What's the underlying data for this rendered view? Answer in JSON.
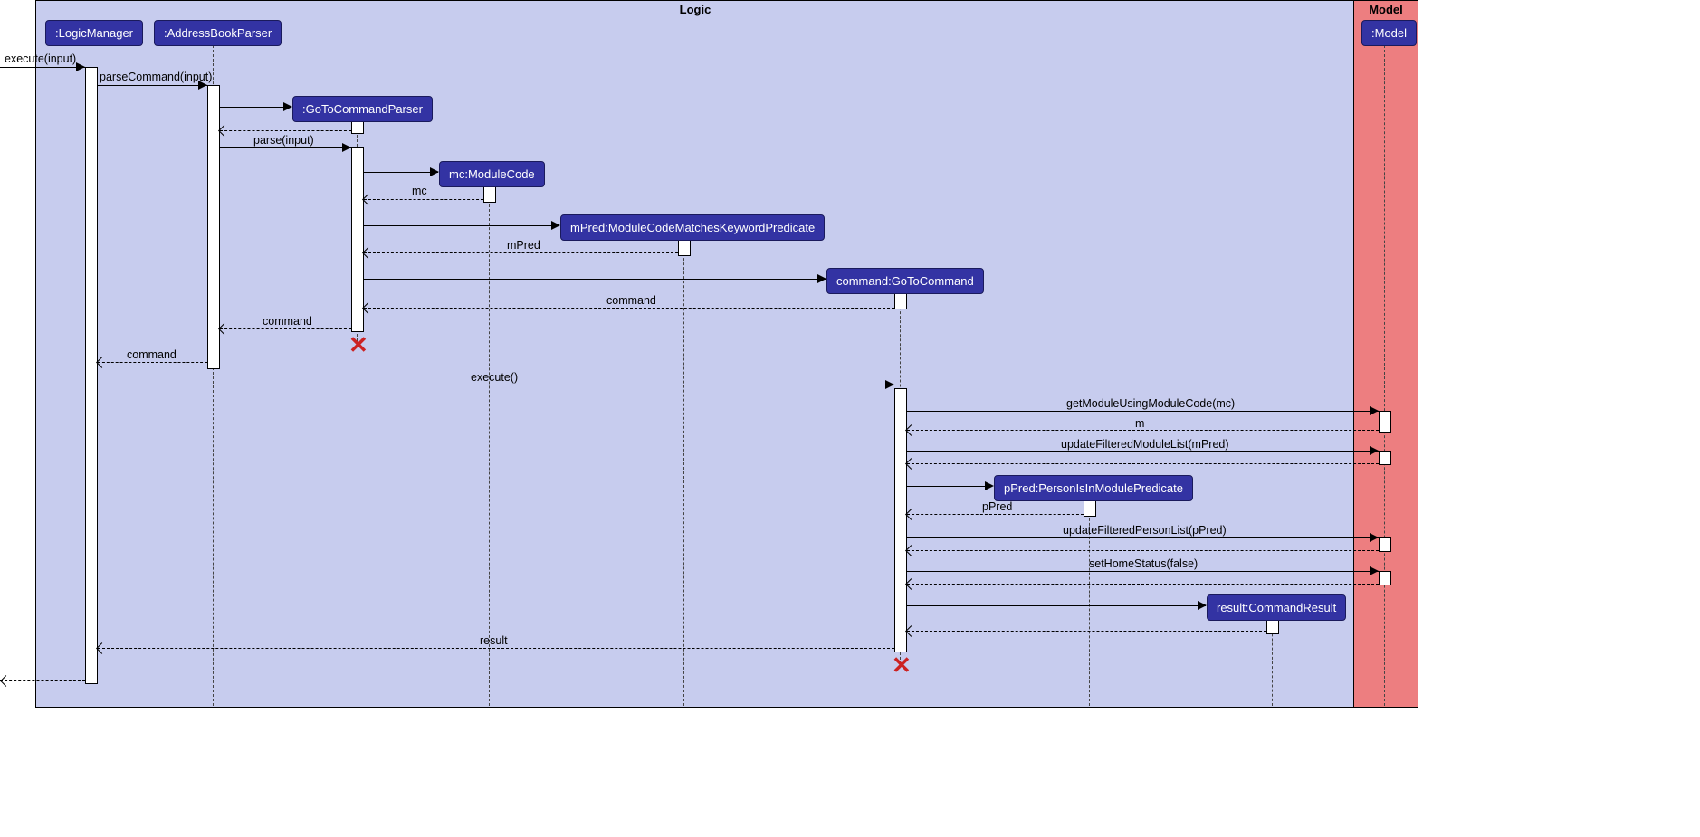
{
  "regions": {
    "logic": "Logic",
    "model": "Model"
  },
  "participants": {
    "logicManager": ":LogicManager",
    "addressBookParser": ":AddressBookParser",
    "goToCommandParser": ":GoToCommandParser",
    "moduleCode": "mc:ModuleCode",
    "mPred": "mPred:ModuleCodeMatchesKeywordPredicate",
    "goToCommand": "command:GoToCommand",
    "model": ":Model",
    "pPred": "pPred:PersonIsInModulePredicate",
    "commandResult": "result:CommandResult"
  },
  "messages": {
    "execute_input": "execute(input)",
    "parseCommand": "parseCommand(input)",
    "parse_input": "parse(input)",
    "mc_return": "mc",
    "mPred_return": "mPred",
    "command_return1": "command",
    "command_return2": "command",
    "command_return3": "command",
    "execute_call": "execute()",
    "getModule": "getModuleUsingModuleCode(mc)",
    "m_return": "m",
    "updateModuleList": "updateFilteredModuleList(mPred)",
    "pPred_return": "pPred",
    "updatePersonList": "updateFilteredPersonList(pPred)",
    "setHomeStatus": "setHomeStatus(false)",
    "result_return": "result"
  }
}
